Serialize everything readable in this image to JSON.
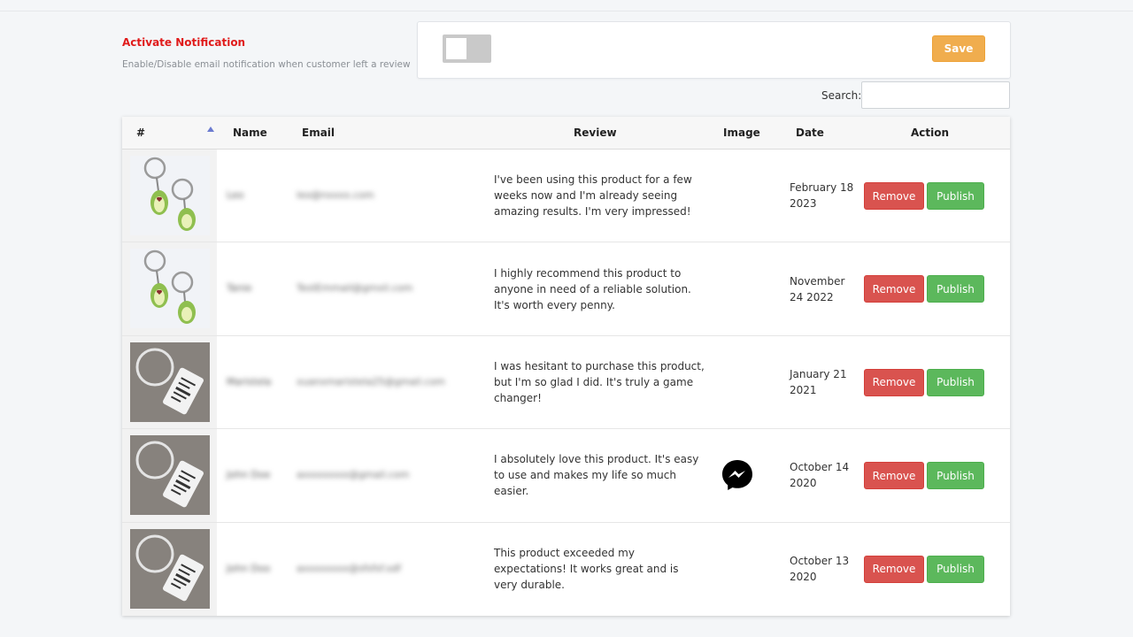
{
  "settings": {
    "title": "Activate Notification",
    "description": "Enable/Disable email notification when customer left a review",
    "toggle_state": "off",
    "save_label": "Save"
  },
  "search": {
    "label": "Search:",
    "value": ""
  },
  "table": {
    "columns": [
      "#",
      "Name",
      "Email",
      "Review",
      "Image",
      "Date",
      "Action"
    ],
    "rows": [
      {
        "thumb": "avocado-keychain",
        "name": "Leo",
        "email": "leo@nxxxx.com",
        "review": "I've been using this product for a few weeks now and I'm already seeing amazing results. I'm very impressed!",
        "image": "",
        "date": "February 18 2023",
        "remove_label": "Remove",
        "publish_label": "Publish"
      },
      {
        "thumb": "avocado-keychain",
        "name": "Tanie",
        "email": "TestEmmail@gmxil.com",
        "review": "I highly recommend this product to anyone in need of a reliable solution. It's worth every penny.",
        "image": "",
        "date": "November 24 2022",
        "remove_label": "Remove",
        "publish_label": "Publish"
      },
      {
        "thumb": "engraved-tag-keychain",
        "name": "Maristela",
        "email": "xuanxmaristela25@gmail.com",
        "review": "I was hesitant to purchase this product, but I'm so glad I did. It's truly a game changer!",
        "image": "",
        "date": "January 21 2021",
        "remove_label": "Remove",
        "publish_label": "Publish"
      },
      {
        "thumb": "engraved-tag-keychain",
        "name": "John Doe",
        "email": "axxxxxxxx@gmail.com",
        "review": "I absolutely love this product. It's easy to use and makes my life so much easier.",
        "image": "messenger-icon",
        "date": "October 14 2020",
        "remove_label": "Remove",
        "publish_label": "Publish"
      },
      {
        "thumb": "engraved-tag-keychain",
        "name": "John Doo",
        "email": "axxxxxxxx@sfsfsf.sdf",
        "review": "This product exceeded my expectations! It works great and is very durable.",
        "image": "",
        "date": "October 13 2020",
        "remove_label": "Remove",
        "publish_label": "Publish"
      }
    ]
  },
  "colors": {
    "title_red": "#e01b1b",
    "save_orange": "#f0ad4e",
    "remove_red": "#d9534f",
    "publish_green": "#5cb85c",
    "sort_blue": "#6b7bd0"
  }
}
